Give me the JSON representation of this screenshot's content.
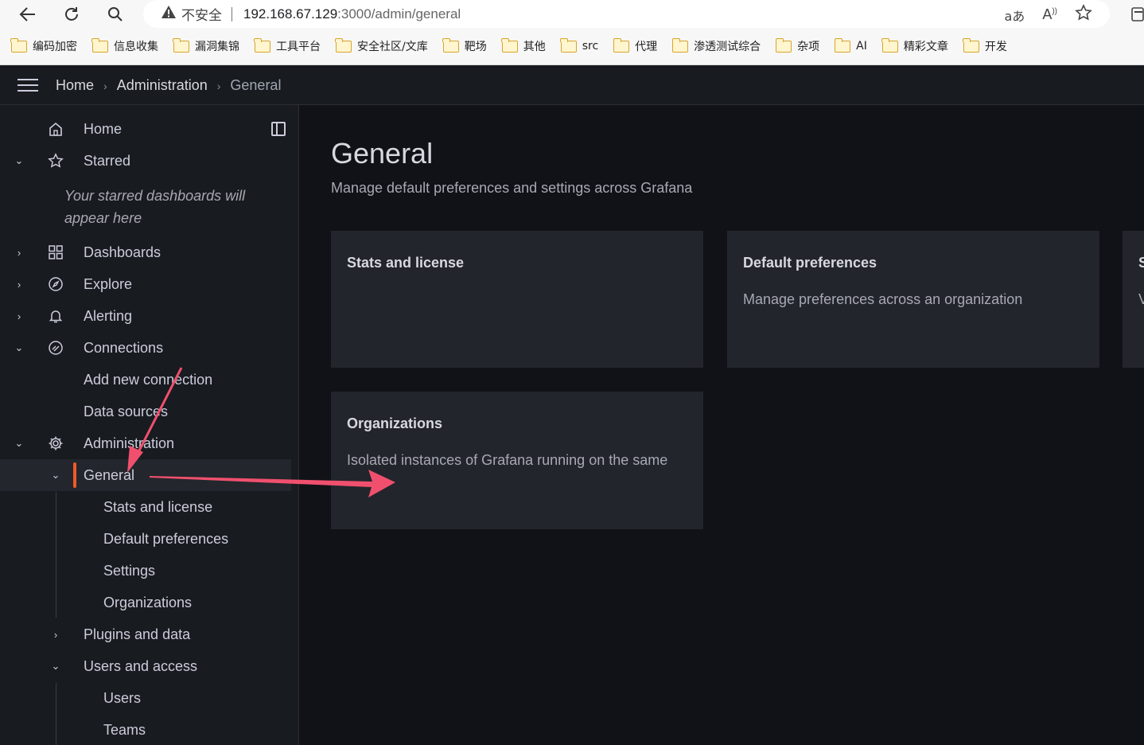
{
  "browser": {
    "security_label": "不安全",
    "url_host": "192.168.67.129",
    "url_path": ":3000/admin/general",
    "translate_label": "aあ",
    "read_aloud_label": "A",
    "bookmarks": [
      {
        "label": "编码加密"
      },
      {
        "label": "信息收集"
      },
      {
        "label": "漏洞集锦"
      },
      {
        "label": "工具平台"
      },
      {
        "label": "安全社区/文库"
      },
      {
        "label": "靶场"
      },
      {
        "label": "其他"
      },
      {
        "label": "src"
      },
      {
        "label": "代理"
      },
      {
        "label": "渗透测试综合"
      },
      {
        "label": "杂项"
      },
      {
        "label": "AI"
      },
      {
        "label": "精彩文章"
      },
      {
        "label": "开发"
      }
    ]
  },
  "breadcrumb": {
    "items": [
      "Home",
      "Administration",
      "General"
    ]
  },
  "sidebar": {
    "home": "Home",
    "starred": "Starred",
    "starred_note": "Your starred dashboards will appear here",
    "dashboards": "Dashboards",
    "explore": "Explore",
    "alerting": "Alerting",
    "connections": "Connections",
    "add_new_connection": "Add new connection",
    "data_sources": "Data sources",
    "administration": "Administration",
    "general": "General",
    "stats_and_license": "Stats and license",
    "default_preferences": "Default preferences",
    "settings": "Settings",
    "organizations": "Organizations",
    "plugins_and_data": "Plugins and data",
    "users_and_access": "Users and access",
    "users": "Users",
    "teams": "Teams"
  },
  "main": {
    "title": "General",
    "subtitle": "Manage default preferences and settings across Grafana",
    "cards": [
      {
        "title": "Stats and license",
        "description": ""
      },
      {
        "title": "Default preferences",
        "description": "Manage preferences across an organization"
      },
      {
        "title": "S",
        "description": "V"
      },
      {
        "title": "Organizations",
        "description": "Isolated instances of Grafana running on the same"
      }
    ]
  },
  "colors": {
    "accent": "#f05a28",
    "annotation_arrow": "#f0506e",
    "sidebar_bg": "#181b1f",
    "main_bg": "#111217",
    "card_bg": "#22252b"
  }
}
